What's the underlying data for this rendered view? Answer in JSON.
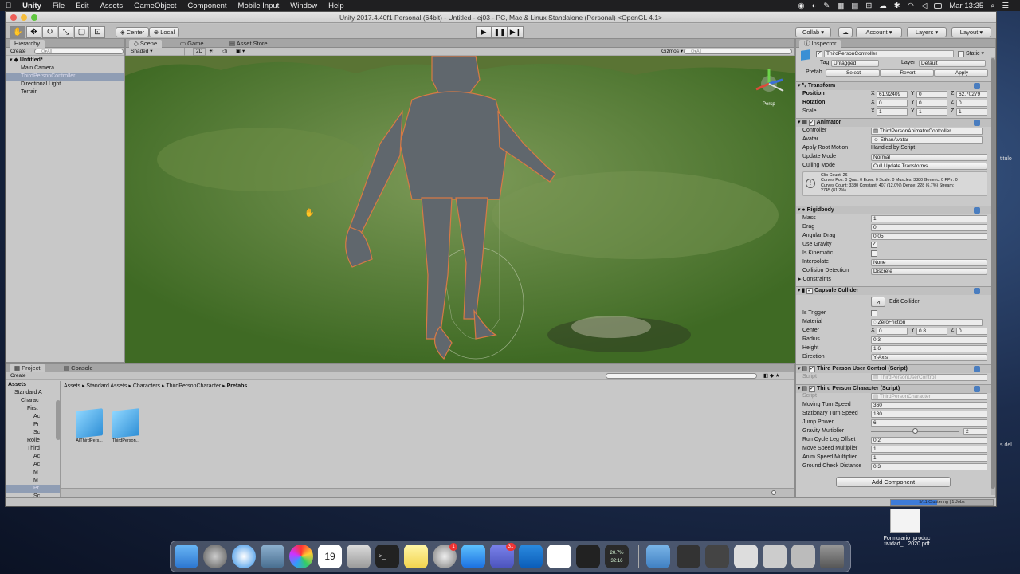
{
  "menubar": {
    "app": "Unity",
    "items": [
      "File",
      "Edit",
      "Assets",
      "GameObject",
      "Component",
      "Mobile Input",
      "Window",
      "Help"
    ],
    "clock": "Mar 13:35"
  },
  "window": {
    "title": "Unity 2017.4.40f1 Personal (64bit) - Untitled - ej03 - PC, Mac & Linux Standalone (Personal) <OpenGL 4.1>"
  },
  "toolbar": {
    "center": "Center",
    "local": "Local",
    "collab": "Collab",
    "account": "Account",
    "layers": "Layers",
    "layout": "Layout"
  },
  "hierarchy": {
    "tab": "Hierarchy",
    "create": "Create",
    "search_placeholder": "Q▾All",
    "scene": "Untitled*",
    "items": [
      "Main Camera",
      "ThirdPersonController",
      "Directional Light",
      "Terrain"
    ]
  },
  "scene": {
    "tabs": [
      "Scene",
      "Game",
      "Asset Store"
    ],
    "shading": "Shaded",
    "mode2d": "2D",
    "gizmos": "Gizmos",
    "search_placeholder": "Q▾All",
    "persp": "Persp"
  },
  "project": {
    "tabs": [
      "Project",
      "Console"
    ],
    "create": "Create",
    "tree": [
      "Assets",
      "Standard A",
      "Charac",
      "First",
      "Ac",
      "Pr",
      "Sc",
      "Rolle",
      "Third",
      "Ac",
      "Ac",
      "M",
      "M",
      "Pr",
      "Sc"
    ],
    "breadcrumb": [
      "Assets",
      "Standard Assets",
      "Characters",
      "ThirdPersonCharacter",
      "Prefabs"
    ],
    "files": [
      "AIThirdPers...",
      "ThirdPerson..."
    ]
  },
  "status": {
    "progress": "5/11 Clustering | 1 Jobs",
    "progress_fraction": 0.45
  },
  "inspector": {
    "tab": "Inspector",
    "name": "ThirdPersonController",
    "static": "Static",
    "tag_label": "Tag",
    "tag": "Untagged",
    "layer_label": "Layer",
    "layer": "Default",
    "prefab": "Prefab",
    "select": "Select",
    "revert": "Revert",
    "apply": "Apply",
    "transform": {
      "title": "Transform",
      "position": "Position",
      "rotation": "Rotation",
      "scale": "Scale",
      "pos": [
        "61.92409",
        "0",
        "62.70279"
      ],
      "rot": [
        "0",
        "0",
        "0"
      ],
      "scl": [
        "1",
        "1",
        "1"
      ]
    },
    "animator": {
      "title": "Animator",
      "controller_label": "Controller",
      "controller": "ThirdPersonAnimatorController",
      "avatar_label": "Avatar",
      "avatar": "EthanAvatar",
      "root_motion_label": "Apply Root Motion",
      "root_motion": "Handled by Script",
      "update_label": "Update Mode",
      "update": "Normal",
      "culling_label": "Culling Mode",
      "culling": "Cull Update Transforms",
      "info1": "Clip Count: 26",
      "info2": "Curves Pos: 0 Quat: 0 Euler: 0 Scale: 0 Muscles: 3380 Generic: 0 PPtr: 0",
      "info3": "Curves Count: 3380 Constant: 407 (12.0%) Dense: 228 (6.7%) Stream:",
      "info4": "2745 (81.2%)"
    },
    "rigidbody": {
      "title": "Rigidbody",
      "mass_label": "Mass",
      "mass": "1",
      "drag_label": "Drag",
      "drag": "0",
      "angdrag_label": "Angular Drag",
      "angdrag": "0.05",
      "gravity_label": "Use Gravity",
      "kinematic_label": "Is Kinematic",
      "interp_label": "Interpolate",
      "interp": "None",
      "collision_label": "Collision Detection",
      "collision": "Discrete",
      "constraints": "Constraints"
    },
    "capsule": {
      "title": "Capsule Collider",
      "edit": "Edit Collider",
      "trigger_label": "Is Trigger",
      "material_label": "Material",
      "material": "ZeroFriction",
      "center_label": "Center",
      "center": [
        "0",
        "0.8",
        "0"
      ],
      "radius_label": "Radius",
      "radius": "0.3",
      "height_label": "Height",
      "height": "1.6",
      "direction_label": "Direction",
      "direction": "Y-Axis"
    },
    "userctrl": {
      "title": "Third Person User Control (Script)",
      "script_label": "Script",
      "script": "ThirdPersonUserControl"
    },
    "character": {
      "title": "Third Person Character (Script)",
      "script_label": "Script",
      "script": "ThirdPersonCharacter",
      "rows": [
        [
          "Moving Turn Speed",
          "360"
        ],
        [
          "Stationary Turn Speed",
          "180"
        ],
        [
          "Jump Power",
          "6"
        ],
        [
          "Gravity Multiplier",
          "2"
        ],
        [
          "Run Cycle Leg Offset",
          "0.2"
        ],
        [
          "Move Speed Multiplier",
          "1"
        ],
        [
          "Anim Speed Multiplier",
          "1"
        ],
        [
          "Ground Check Distance",
          "0.3"
        ]
      ],
      "gravity_slider_fraction": 0.5
    },
    "add_component": "Add Component"
  },
  "desktop": {
    "file_label": "Formulario_produc\ntividad_...2020.pdf",
    "side_text1": "titulo",
    "side_text2": "s del",
    "dock_monitor": "20.7%",
    "dock_time": "32:16",
    "dock_badge": "31"
  }
}
